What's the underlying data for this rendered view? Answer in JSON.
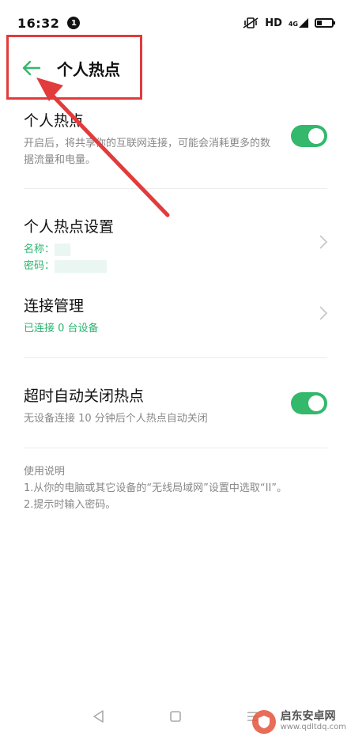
{
  "status_bar": {
    "time": "16:32",
    "notification_count": "1",
    "network_label": "HD",
    "signal_label": "4G"
  },
  "app_bar": {
    "title": "个人热点"
  },
  "hotspot": {
    "title": "个人热点",
    "description": "开启后，将共享你的互联网连接，可能会消耗更多的数据流量和电量。",
    "enabled": true
  },
  "settings": {
    "title": "个人热点设置",
    "name_label": "名称：",
    "password_label": "密码："
  },
  "connections": {
    "title": "连接管理",
    "status": "已连接 0 台设备"
  },
  "timeout": {
    "title": "超时自动关闭热点",
    "description": "无设备连接 10 分钟后个人热点自动关闭",
    "enabled": true
  },
  "instructions": {
    "heading": "使用说明",
    "step1": "1.从你的电脑或其它设备的“无线局域网”设置中选取“II”。",
    "step2": "2.提示时输入密码。"
  },
  "watermark": {
    "name": "启东安卓网",
    "url": "www.qdltdq.com"
  },
  "colors": {
    "accent": "#33b86c",
    "annotation": "#e23b3b"
  }
}
